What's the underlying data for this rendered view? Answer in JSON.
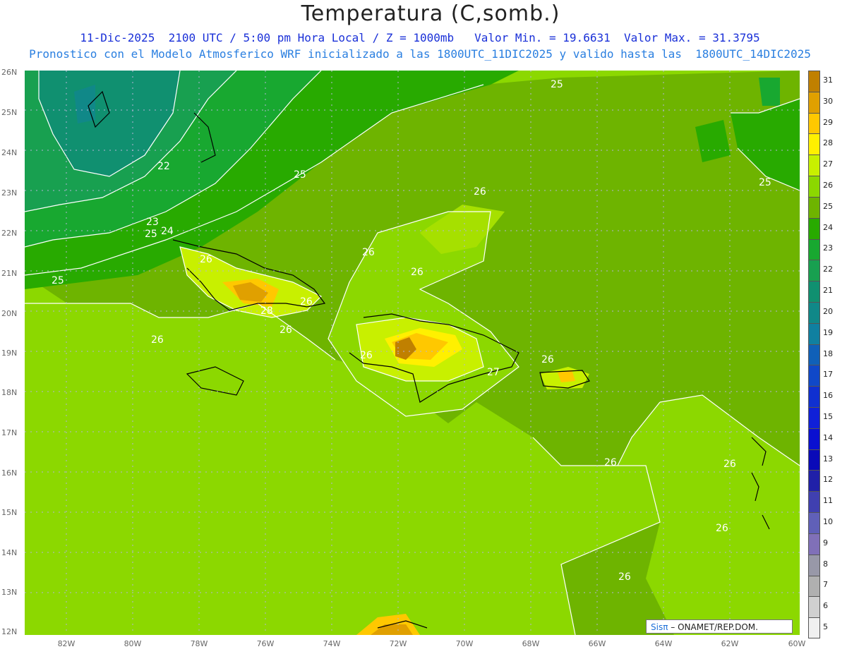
{
  "title": "Temperatura (C,somb.)",
  "subtitle_line1": "11-Dic-2025  2100 UTC / 5:00 pm Hora Local / Z = 1000mb   Valor Min. = 19.6631  Valor Max. = 31.3795",
  "subtitle_line2": "Pronostico con el Modelo Atmosferico WRF inicializado a las 1800UTC_11DIC2025 y valido hasta las  1800UTC_14DIC2025",
  "latitude_labels": [
    "26N",
    "25N",
    "24N",
    "23N",
    "22N",
    "21N",
    "20N",
    "19N",
    "18N",
    "17N",
    "16N",
    "15N",
    "14N",
    "13N",
    "12N"
  ],
  "longitude_labels": [
    "82W",
    "80W",
    "78W",
    "76W",
    "74W",
    "72W",
    "70W",
    "68W",
    "66W",
    "64W",
    "62W",
    "60W"
  ],
  "contour_labels": [
    "25",
    "22",
    "26",
    "23",
    "25",
    "24",
    "26",
    "25",
    "25",
    "26",
    "26",
    "26",
    "26",
    "26",
    "26",
    "26",
    "27",
    "26",
    "26",
    "26",
    "26",
    "28",
    "25"
  ],
  "colorbar": {
    "levels": [
      "31",
      "30",
      "29",
      "28",
      "27",
      "26",
      "25",
      "24",
      "23",
      "22",
      "21",
      "20",
      "19",
      "18",
      "17",
      "16",
      "15",
      "14",
      "13",
      "12",
      "11",
      "10",
      "9",
      "8",
      "7",
      "6",
      "5"
    ],
    "colors": [
      "#c08000",
      "#e0a000",
      "#ffc800",
      "#fff000",
      "#c8f000",
      "#8cd800",
      "#6eb400",
      "#28aa00",
      "#18a830",
      "#18a050",
      "#109070",
      "#108888",
      "#1080a0",
      "#1060b8",
      "#1048c8",
      "#1030d0",
      "#1020d8",
      "#0a10d0",
      "#0a0ab8",
      "#2020a8",
      "#4040b0",
      "#6060b8",
      "#8070b8",
      "#9898a8",
      "#b0b0b0",
      "#d0d0d0",
      "#f0f0f0"
    ]
  },
  "credit": {
    "brand": "Sisπ",
    "text": " – ONAMET/REP.DOM."
  }
}
